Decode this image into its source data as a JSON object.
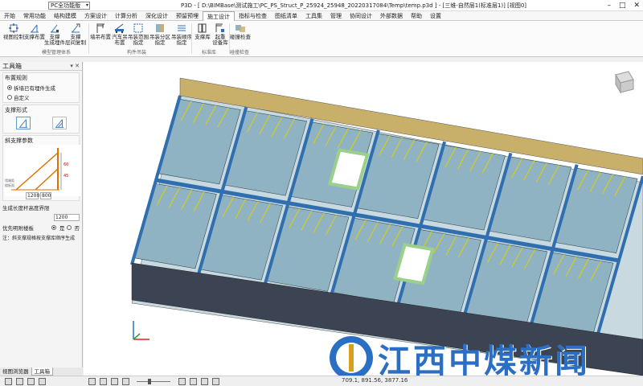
{
  "titlebar": {
    "app_selector": "PC全功能版",
    "title": "P3D - [ D:\\BIMBase\\测试施工\\PC_PS_Struct_P_25924_25948_20220317084\\Temp\\temp.p3d ] - [三维-自然层1(标准层1)] [视图0]"
  },
  "menu": {
    "items": [
      "开始",
      "常用功能",
      "结构建模",
      "方案设计",
      "计算分析",
      "深化设计",
      "预留预埋",
      "施工设计",
      "指标与检查",
      "图纸清单",
      "工具集",
      "管理",
      "协同设计",
      "外部数据",
      "帮助",
      "设置"
    ],
    "active": "施工设计"
  },
  "ribbon": {
    "buttons": [
      {
        "label": "视图控制",
        "key": "view-control"
      },
      {
        "label": "支撑布置",
        "key": "support-layout"
      },
      {
        "label": "支撑\n生成埋件",
        "key": "support-embed"
      },
      {
        "label": "支撑\n层间复制",
        "key": "support-copy"
      },
      {
        "label": "墙吊布置",
        "key": "wall-hoist"
      },
      {
        "label": "汽车吊\n布置",
        "key": "truck-crane"
      },
      {
        "label": "吊装范围\n指定",
        "key": "hoist-range"
      },
      {
        "label": "吊装分区\n指定",
        "key": "hoist-zone"
      },
      {
        "label": "吊装顺序\n指定",
        "key": "hoist-order"
      },
      {
        "label": "支撑库",
        "key": "support-lib"
      },
      {
        "label": "起重\n设备库",
        "key": "crane-lib"
      },
      {
        "label": "碰撞检查",
        "key": "collision-check"
      }
    ],
    "groups": [
      "模型管理体系",
      "构件吊装",
      "标准库",
      "碰撞检查"
    ]
  },
  "toolbox": {
    "title": "工具箱",
    "layout_rule_title": "布置规则",
    "layout_rule_options": [
      "拆墙已有埋件生成",
      "自定义"
    ],
    "support_form_title": "支撑形式",
    "param_title": "斜支撑参数",
    "diagram_labels": [
      "1200",
      "800",
      "60",
      "45"
    ],
    "side_labels": [
      "墙端距",
      "楼板面"
    ],
    "height_label": "生成长度杆高度界限",
    "height_value": "1200",
    "priority_label": "优先明附楼板",
    "priority_yes": "是",
    "priority_no": "否",
    "note": "注：斜支撑规格按支撑库顺序生成"
  },
  "left_tabs": [
    "视图浏览器",
    "工具箱"
  ],
  "left_tab_active": "工具箱",
  "status": {
    "coords": "709.1, 891.56, 3877.16"
  },
  "watermark": {
    "text": "江西中煤新闻"
  },
  "colors": {
    "accent": "#2b6fc4",
    "wall": "#c8b06a",
    "slab": "#8fb3c2",
    "beam": "#2f6fb0",
    "wall_green": "#9ad08a",
    "prop": "#e0d000"
  }
}
